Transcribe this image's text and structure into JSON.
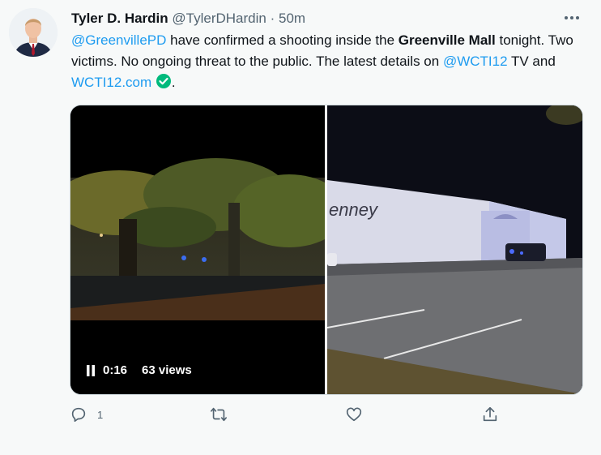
{
  "author": {
    "name": "Tyler D. Hardin",
    "handle": "@TylerDHardin",
    "separator": "·",
    "time": "50m"
  },
  "tweet": {
    "mention1": "@GreenvillePD",
    "text1": " have confirmed a shooting inside the ",
    "bold1": "Greenville Mall",
    "text2": " tonight. Two victims. No ongoing threat to the public. The latest details on ",
    "mention2": "@WCTI12",
    "text3": " TV and ",
    "link": "WCTI12.com",
    "text4": "."
  },
  "media": {
    "video_time": "0:16",
    "video_views": "63 views",
    "store_sign": "enney"
  },
  "actions": {
    "reply_count": "1"
  },
  "colors": {
    "link": "#1d9bf0",
    "verified": "#00ba7c",
    "muted": "#536471",
    "background": "#f7f9f9"
  },
  "icons": [
    "more-icon",
    "verified-check-icon",
    "pause-icon",
    "reply-icon",
    "retweet-icon",
    "like-icon",
    "share-icon"
  ]
}
